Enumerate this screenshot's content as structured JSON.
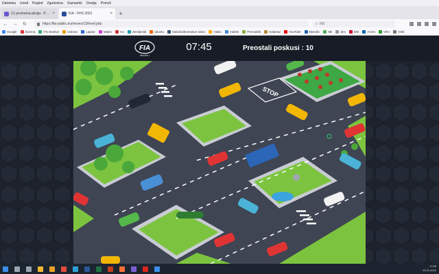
{
  "menubar": {
    "items": [
      "Datoteka",
      "Uredi",
      "Pogled",
      "Zgodovina",
      "Zaznamki",
      "Orodja",
      "Pomoč"
    ]
  },
  "tabs": [
    {
      "label": "(1) prometna-akcija - Preprost",
      "fav": "#6a5acd",
      "active": false
    },
    {
      "label": "FIA - FHS 2021",
      "fav": "#2b4c9a",
      "active": true
    }
  ],
  "newtab_label": "+",
  "nav": {
    "back": "←",
    "forward": "→",
    "reload": "↻",
    "url": "https://fia-public.eu/moves/13/level.php",
    "search_placeholder": "Išči"
  },
  "bookmarks": [
    "Google",
    "Zvezna",
    "IT5 Storitve",
    "Izobraz",
    "Lapitor",
    "Makro",
    "Ko",
    "Zemljevidi",
    "ubuntu",
    "Sobcilolokomotive SaKo",
    "Haiko",
    "Indeks",
    "Prevodnik",
    "Kalamar",
    "YouTube",
    "Marušic",
    "Mk",
    "dns",
    "DW",
    "Arnes",
    "VRA",
    "VSB",
    "Wiki",
    "Zgodovina"
  ],
  "game": {
    "logo_text": "FIA",
    "logo_sub": "REGION I",
    "timer": "07:45",
    "attempts": "Preostali poskusi : 10",
    "stop_text": "STOP"
  },
  "clock": {
    "time": "17:08",
    "date": "23.11.2021"
  },
  "colors": {
    "road": "#3f4553",
    "grass": "#7cc43f",
    "sidewalk": "#c9ccd3",
    "header_bg": "#171c26"
  }
}
